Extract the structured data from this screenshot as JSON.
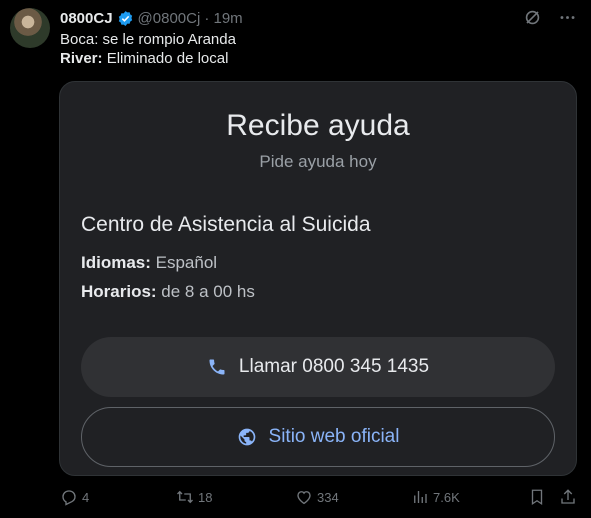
{
  "tweet": {
    "author_name": "0800CJ",
    "author_handle": "@0800Cj",
    "time": "· 19m",
    "line1": "Boca: se le rompio Aranda",
    "line2_label": "River:",
    "line2_text": " Eliminado de local"
  },
  "help_card": {
    "title": "Recibe ayuda",
    "subtitle": "Pide ayuda hoy",
    "center_name": "Centro de Asistencia al Suicida",
    "languages_label": "Idiomas:",
    "languages_value": " Español",
    "hours_label": "Horarios:",
    "hours_value": " de 8 a 00 hs",
    "call_button": "Llamar 0800 345 1435",
    "website_button": "Sitio web oficial"
  },
  "stats": {
    "replies": "4",
    "reposts": "18",
    "likes": "334",
    "views": "7.6K"
  },
  "icons": {
    "verified": "verified-badge-icon",
    "grok": "grok-icon",
    "more": "more-icon",
    "phone": "phone-icon",
    "globe": "globe-icon",
    "reply": "reply-icon",
    "repost": "repost-icon",
    "like": "heart-icon",
    "views": "views-icon",
    "bookmark": "bookmark-icon",
    "share": "share-icon"
  },
  "colors": {
    "background": "#000000",
    "card": "#202124",
    "link_blue": "#8ab4f8",
    "verified_blue": "#1d9bf0",
    "muted": "#71767b"
  }
}
